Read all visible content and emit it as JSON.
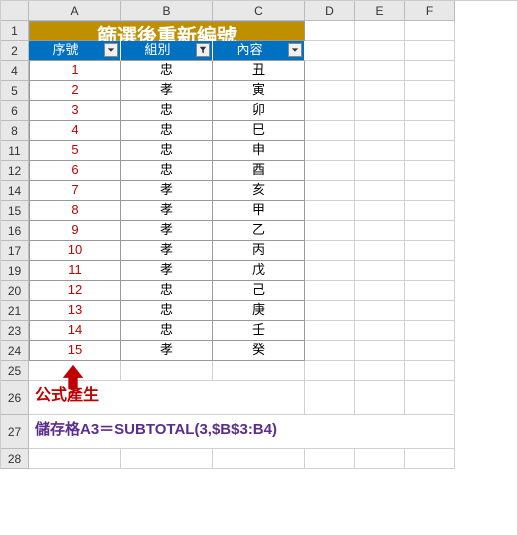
{
  "columns": [
    "A",
    "B",
    "C",
    "D",
    "E",
    "F"
  ],
  "title": "篩選後重新編號",
  "headers": {
    "seq": "序號",
    "group": "組別",
    "content": "內容"
  },
  "rows": [
    {
      "rn": 4,
      "seq": 1,
      "group": "忠",
      "content": "丑"
    },
    {
      "rn": 5,
      "seq": 2,
      "group": "孝",
      "content": "寅"
    },
    {
      "rn": 6,
      "seq": 3,
      "group": "忠",
      "content": "卯"
    },
    {
      "rn": 8,
      "seq": 4,
      "group": "忠",
      "content": "巳"
    },
    {
      "rn": 11,
      "seq": 5,
      "group": "忠",
      "content": "申"
    },
    {
      "rn": 12,
      "seq": 6,
      "group": "忠",
      "content": "酉"
    },
    {
      "rn": 14,
      "seq": 7,
      "group": "孝",
      "content": "亥"
    },
    {
      "rn": 15,
      "seq": 8,
      "group": "孝",
      "content": "甲"
    },
    {
      "rn": 16,
      "seq": 9,
      "group": "孝",
      "content": "乙"
    },
    {
      "rn": 17,
      "seq": 10,
      "group": "孝",
      "content": "丙"
    },
    {
      "rn": 19,
      "seq": 11,
      "group": "孝",
      "content": "戊"
    },
    {
      "rn": 20,
      "seq": 12,
      "group": "忠",
      "content": "己"
    },
    {
      "rn": 21,
      "seq": 13,
      "group": "忠",
      "content": "庚"
    },
    {
      "rn": 23,
      "seq": 14,
      "group": "忠",
      "content": "壬"
    },
    {
      "rn": 24,
      "seq": 15,
      "group": "孝",
      "content": "癸"
    }
  ],
  "annotation": {
    "arrow_label": "公式產生",
    "formula": "儲存格A3＝SUBTOTAL(3,$B$3:B4)"
  },
  "extra_row_numbers": [
    25,
    26,
    27,
    28
  ],
  "chart_data": {
    "type": "table",
    "title": "篩選後重新編號",
    "columns": [
      "序號",
      "組別",
      "內容"
    ],
    "data": [
      [
        1,
        "忠",
        "丑"
      ],
      [
        2,
        "孝",
        "寅"
      ],
      [
        3,
        "忠",
        "卯"
      ],
      [
        4,
        "忠",
        "巳"
      ],
      [
        5,
        "忠",
        "申"
      ],
      [
        6,
        "忠",
        "酉"
      ],
      [
        7,
        "孝",
        "亥"
      ],
      [
        8,
        "孝",
        "甲"
      ],
      [
        9,
        "孝",
        "乙"
      ],
      [
        10,
        "孝",
        "丙"
      ],
      [
        11,
        "孝",
        "戊"
      ],
      [
        12,
        "忠",
        "己"
      ],
      [
        13,
        "忠",
        "庚"
      ],
      [
        14,
        "忠",
        "壬"
      ],
      [
        15,
        "孝",
        "癸"
      ]
    ]
  }
}
